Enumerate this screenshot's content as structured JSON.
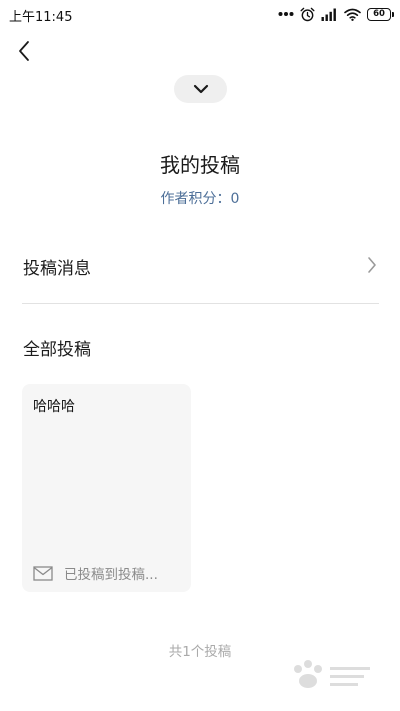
{
  "status_bar": {
    "time": "上午11:45",
    "battery": "60",
    "icons": [
      "more-dots-icon",
      "alarm-clock-icon",
      "cellular-signal-icon",
      "wifi-icon",
      "battery-icon"
    ]
  },
  "header": {
    "back_icon": "chevron-left-icon",
    "collapse_icon": "chevron-down-icon"
  },
  "profile": {
    "title": "我的投稿",
    "points_label": "作者积分：0"
  },
  "messages_row": {
    "label": "投稿消息",
    "icon": "chevron-right-icon"
  },
  "all_submissions": {
    "title": "全部投稿",
    "cards": [
      {
        "title": "哈哈哈",
        "status_icon": "mail-icon",
        "status": "已投稿到投稿..."
      }
    ],
    "total": "共1个投稿"
  },
  "colors": {
    "accent_blue": "#4d6f98",
    "card_bg": "#f6f6f6",
    "pill_bg": "#efefef",
    "muted_text": "#8a8a8a"
  }
}
